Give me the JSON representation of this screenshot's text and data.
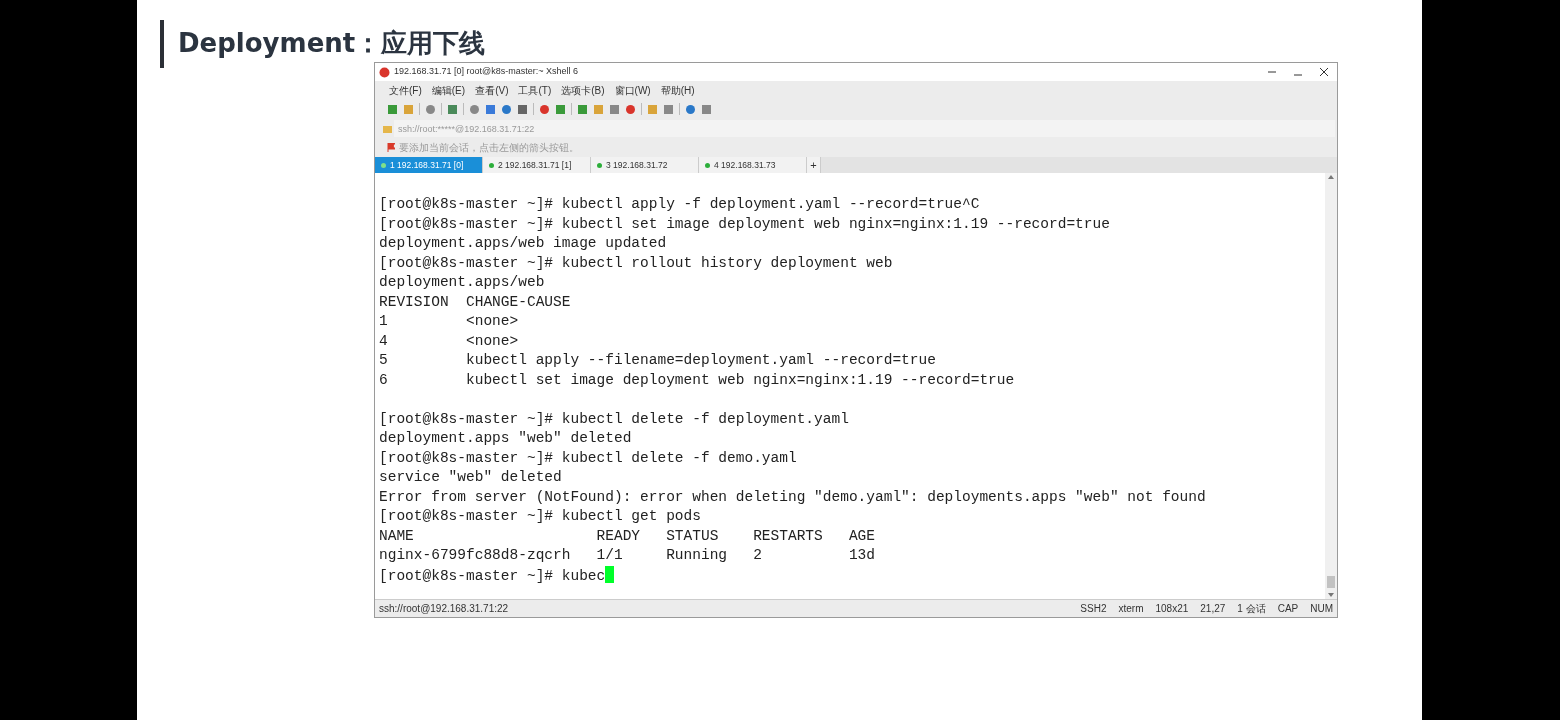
{
  "slide": {
    "title": "Deployment：应用下线"
  },
  "window": {
    "title": "192.168.31.71 [0]    root@k8s-master:~    Xshell 6"
  },
  "menu": [
    "文件(F)",
    "编辑(E)",
    "查看(V)",
    "工具(T)",
    "选项卡(B)",
    "窗口(W)",
    "帮助(H)"
  ],
  "address_bar": {
    "value": "ssh://root:*****@192.168.31.71:22"
  },
  "hint_bar": {
    "text": "要添加当前会话，点击左侧的箭头按钮。"
  },
  "tabs": [
    {
      "label": "1 192.168.31.71 [0]",
      "selected": true
    },
    {
      "label": "2 192.168.31.71 [1]",
      "selected": false
    },
    {
      "label": "3 192.168.31.72",
      "selected": false
    },
    {
      "label": "4 192.168.31.73",
      "selected": false
    }
  ],
  "new_tab": "+",
  "terminal": {
    "blocks": [
      [
        "[root@k8s-master ~]# kubectl apply -f deployment.yaml --record=true^C",
        "[root@k8s-master ~]# kubectl set image deployment web nginx=nginx:1.19 --record=true",
        "deployment.apps/web image updated",
        "[root@k8s-master ~]# kubectl rollout history deployment web",
        "deployment.apps/web",
        "REVISION  CHANGE-CAUSE",
        "1         <none>",
        "4         <none>",
        "5         kubectl apply --filename=deployment.yaml --record=true",
        "6         kubectl set image deployment web nginx=nginx:1.19 --record=true"
      ],
      [
        "[root@k8s-master ~]# kubectl delete -f deployment.yaml",
        "deployment.apps \"web\" deleted",
        "[root@k8s-master ~]# kubectl delete -f demo.yaml",
        "service \"web\" deleted",
        "Error from server (NotFound): error when deleting \"demo.yaml\": deployments.apps \"web\" not found",
        "[root@k8s-master ~]# kubectl get pods",
        "NAME                     READY   STATUS    RESTARTS   AGE",
        "nginx-6799fc88d8-zqcrh   1/1     Running   2          13d"
      ]
    ],
    "input_line": {
      "text": "[root@k8s-master ~]# kubec",
      "cursor": true
    }
  },
  "status_bar": {
    "address": "ssh://root@192.168.31.71:22",
    "items": [
      "SSH2",
      "xterm",
      "108x21",
      "21,27",
      "1 会话",
      "CAP",
      "NUM"
    ]
  }
}
